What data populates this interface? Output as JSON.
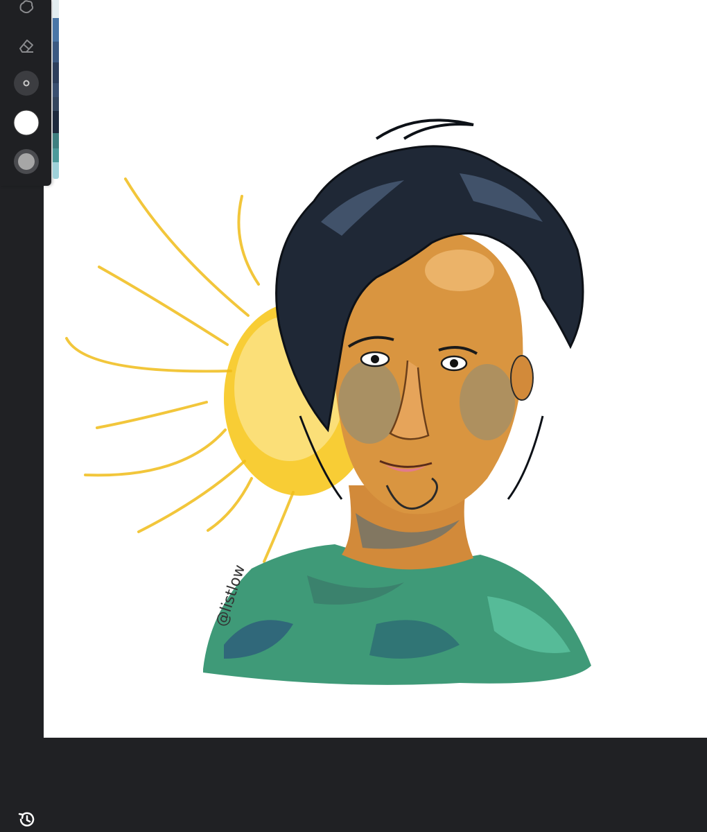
{
  "toolbar": {
    "tools": [
      {
        "name": "smudge-tool",
        "icon": "smudge-icon"
      },
      {
        "name": "eraser-tool",
        "icon": "eraser-icon"
      },
      {
        "name": "brush-size-control",
        "icon": "brush-size-icon"
      },
      {
        "name": "primary-color",
        "icon": "color-white-icon",
        "color": "#ffffff"
      },
      {
        "name": "brush-opacity-control",
        "icon": "opacity-icon",
        "color": "#a6a6a6"
      }
    ]
  },
  "palette": {
    "swatches": [
      "#e3edf0",
      "#4a76a6",
      "#3c5a82",
      "#2d3f5c",
      "#3a5070",
      "#34465e",
      "#1e2a3d",
      "#3f7f80",
      "#4d9a9a",
      "#9fd1d9"
    ]
  },
  "canvas": {
    "background": "#ffffff",
    "signature_text": "@listlow"
  },
  "history": {
    "icon": "history-icon"
  },
  "colors": {
    "app_background": "#202124",
    "toolbar_background": "#1f2023",
    "icon_gray": "#8a8b8e"
  }
}
